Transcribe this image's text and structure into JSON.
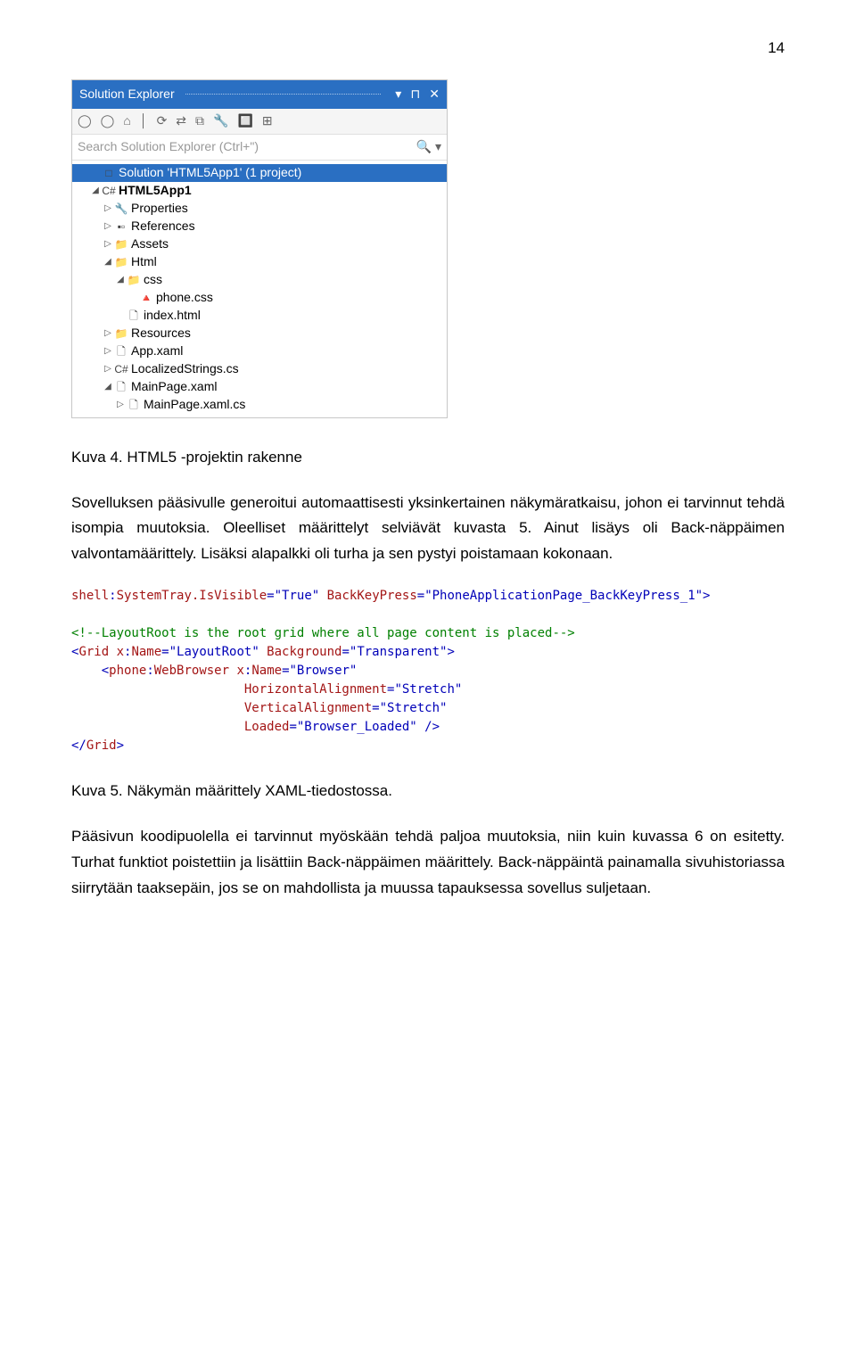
{
  "pagenum": "14",
  "panel": {
    "title": "Solution Explorer",
    "search_placeholder": "Search Solution Explorer (Ctrl+\")",
    "toolbar_icons": [
      "◯",
      "◯",
      "⌂",
      "│",
      "⟳",
      "⇄",
      "⧉",
      "🔧",
      "🔲",
      "⊞"
    ],
    "tree": [
      {
        "indent": 1,
        "arrow": "",
        "icon": "□",
        "text": "Solution 'HTML5App1' (1 project)",
        "sel": true,
        "bold": false
      },
      {
        "indent": 1,
        "arrow": "◢",
        "icon": "C#",
        "text": "HTML5App1",
        "bold": true
      },
      {
        "indent": 2,
        "arrow": "▷",
        "icon": "🔧",
        "text": "Properties"
      },
      {
        "indent": 2,
        "arrow": "▷",
        "icon": "▪▫",
        "text": "References"
      },
      {
        "indent": 2,
        "arrow": "▷",
        "icon": "📁",
        "text": "Assets"
      },
      {
        "indent": 2,
        "arrow": "◢",
        "icon": "📁",
        "text": "Html"
      },
      {
        "indent": 3,
        "arrow": "◢",
        "icon": "📁",
        "text": "css"
      },
      {
        "indent": 4,
        "arrow": "",
        "icon": "🔺",
        "text": "phone.css"
      },
      {
        "indent": 3,
        "arrow": "",
        "icon": "🗋",
        "text": "index.html"
      },
      {
        "indent": 2,
        "arrow": "▷",
        "icon": "📁",
        "text": "Resources"
      },
      {
        "indent": 2,
        "arrow": "▷",
        "icon": "🗋",
        "text": "App.xaml"
      },
      {
        "indent": 2,
        "arrow": "▷",
        "icon": "C#",
        "text": "LocalizedStrings.cs"
      },
      {
        "indent": 2,
        "arrow": "◢",
        "icon": "🗋",
        "text": "MainPage.xaml"
      },
      {
        "indent": 3,
        "arrow": "▷",
        "icon": "🗋",
        "text": "MainPage.xaml.cs"
      }
    ]
  },
  "caption1": "Kuva 4. HTML5 -projektin rakenne",
  "para1": "Sovelluksen pääsivulle generoitui automaattisesti yksinkertainen näkymäratkaisu, johon ei tarvinnut tehdä isompia muutoksia. Oleelliset määrittelyt selviävät kuvasta 5. Ainut lisäys oli Back-näppäimen valvontamäärittely. Lisäksi alapalkki oli turha ja sen pystyi poistamaan kokonaan.",
  "code": {
    "l1a": "shell",
    "l1b": ":",
    "l1c": "SystemTray.IsVisible",
    "l1d": "=\"True\"",
    "l1e": " BackKeyPress",
    "l1f": "=\"PhoneApplicationPage_BackKeyPress_1\">",
    "l2": "<!--LayoutRoot is the root grid where all page content is placed-->",
    "l3a": "<",
    "l3b": "Grid",
    "l3c": " x",
    "l3d": ":",
    "l3e": "Name",
    "l3f": "=\"LayoutRoot\"",
    "l3g": " Background",
    "l3h": "=\"Transparent\">",
    "l4a": "    <",
    "l4b": "phone",
    "l4c": ":",
    "l4d": "WebBrowser",
    "l4e": " x",
    "l4f": ":",
    "l4g": "Name",
    "l4h": "=\"Browser\"",
    "l5a": "                       HorizontalAlignment",
    "l5b": "=\"Stretch\"",
    "l6a": "                       VerticalAlignment",
    "l6b": "=\"Stretch\"",
    "l7a": "                       Loaded",
    "l7b": "=\"Browser_Loaded\" />",
    "l8a": "</",
    "l8b": "Grid",
    "l8c": ">"
  },
  "caption2": "Kuva 5. Näkymän määrittely XAML-tiedostossa.",
  "para2": "Pääsivun koodipuolella ei tarvinnut myöskään tehdä paljoa muutoksia, niin kuin kuvassa 6 on esitetty. Turhat funktiot poistettiin ja lisättiin Back-näppäimen määrittely. Back-näppäintä painamalla sivuhistoriassa siirrytään taaksepäin, jos se on mahdollista ja muussa tapauksessa sovellus suljetaan."
}
